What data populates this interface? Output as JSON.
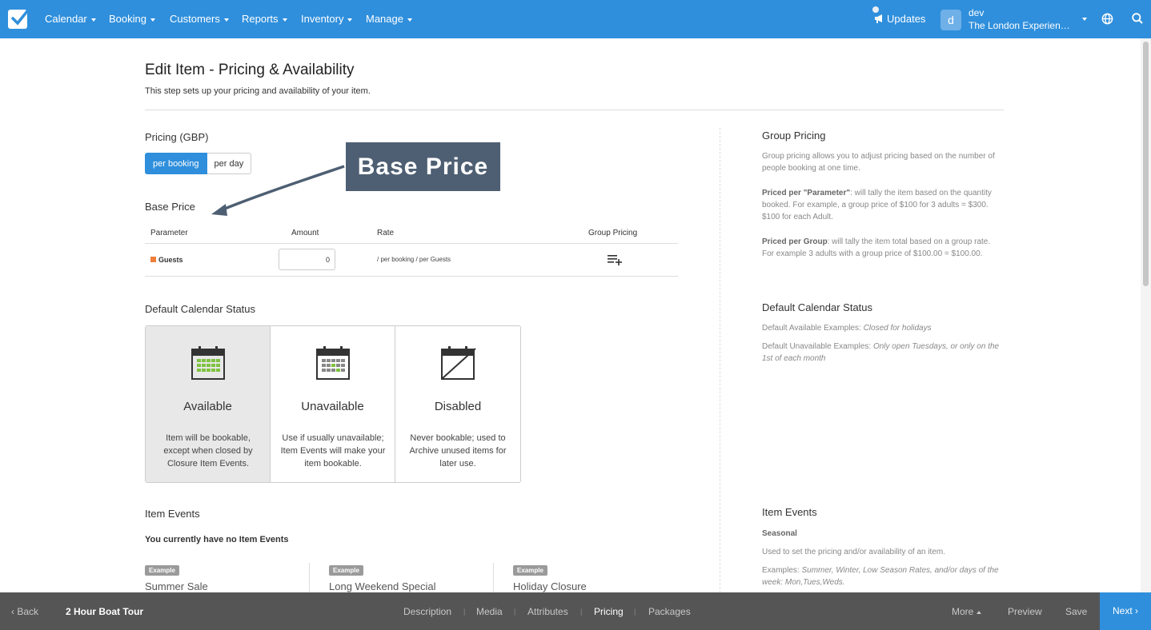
{
  "nav": {
    "items": [
      {
        "label": "Calendar"
      },
      {
        "label": "Booking"
      },
      {
        "label": "Customers"
      },
      {
        "label": "Reports"
      },
      {
        "label": "Inventory"
      },
      {
        "label": "Manage"
      }
    ],
    "updates_label": "Updates",
    "avatar_letter": "d",
    "user_name": "dev",
    "company": "The London Experience Ltd"
  },
  "header": {
    "title": "Edit Item - Pricing & Availability",
    "subtitle": "This step sets up your pricing and availability of your item."
  },
  "pricing": {
    "heading": "Pricing (GBP)",
    "toggle_active": "per booking",
    "toggle_inactive": "per day",
    "annotation": "Base Price",
    "base_price_heading": "Base Price",
    "columns": {
      "parameter": "Parameter",
      "amount": "Amount",
      "rate": "Rate",
      "group_pricing": "Group Pricing"
    },
    "row": {
      "parameter": "Guests",
      "amount": "0",
      "rate": "/ per booking / per Guests",
      "swatch_color": "#ee7f3c"
    }
  },
  "calendar_status": {
    "heading": "Default Calendar Status",
    "cards": [
      {
        "title": "Available",
        "desc": "Item will be bookable, except when closed by Closure Item Events."
      },
      {
        "title": "Unavailable",
        "desc": "Use if usually unavailable; Item Events will make your item bookable."
      },
      {
        "title": "Disabled",
        "desc": "Never bookable; used to Archive unused items for later use."
      }
    ]
  },
  "item_events": {
    "heading": "Item Events",
    "empty": "You currently have no Item Events",
    "badge": "Example",
    "examples": [
      "Summer Sale",
      "Long Weekend Special",
      "Holiday Closure"
    ]
  },
  "help": {
    "group_pricing_heading": "Group Pricing",
    "group_pricing_intro": "Group pricing allows you to adjust pricing based on the number of people booking at one time.",
    "per_param_label": "Priced per \"Parameter\"",
    "per_param_text": ": will tally the item based on the quantity booked. For example, a group price of $100 for 3 adults = $300. $100 for each Adult.",
    "per_group_label": "Priced per Group",
    "per_group_text": ": will tally the item total based on a group rate. For example 3 adults with a group price of $100.00 = $100.00.",
    "status_heading": "Default Calendar Status",
    "avail_label": "Default Available Examples: ",
    "avail_ex": "Closed for holidays",
    "unavail_label": "Default Unavailable Examples: ",
    "unavail_ex": "Only open Tuesdays, or only on the 1st of each month",
    "events_heading": "Item Events",
    "seasonal": "Seasonal",
    "seasonal_desc": "Used to set the pricing and/or availability of an item.",
    "examples_label": "Examples: ",
    "examples_text": "Summer, Winter, Low Season Rates, and/or days of the week: Mon,Tues,Weds."
  },
  "bottom": {
    "back": "Back",
    "item_name": "2 Hour Boat Tour",
    "tabs": [
      "Description",
      "Media",
      "Attributes",
      "Pricing",
      "Packages"
    ],
    "current_tab": "Pricing",
    "more": "More",
    "preview": "Preview",
    "save": "Save",
    "next": "Next"
  },
  "colors": {
    "primary": "#2f8fdc",
    "bottom_bar": "#555555",
    "annotation_bg": "#4e5f73"
  }
}
